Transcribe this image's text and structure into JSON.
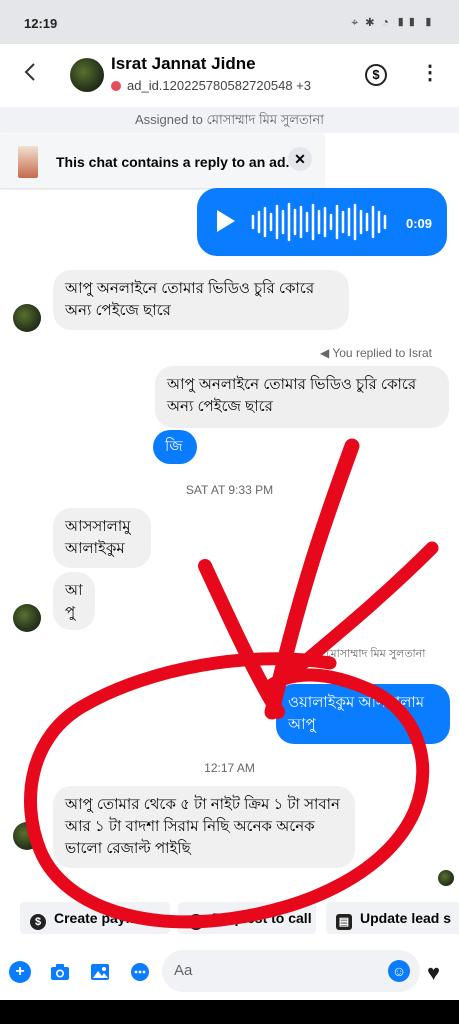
{
  "status_bar": {
    "time": "12:19",
    "icons": "⌖ ✱ ◔ ▮▮ ▮"
  },
  "header": {
    "name": "Israt Jannat Jidne",
    "subtitle": "ad_id.120225780582720548 +3",
    "back_icon": "chevron-left",
    "payment_icon": "$",
    "more_icon": "⋮"
  },
  "assigned_bar": "Assigned to মোসাম্মাদ মিম সুলতানা",
  "ad_banner": {
    "text": "This chat contains a reply to an ad.",
    "close": "✕"
  },
  "messages": {
    "voice": {
      "duration": "0:09"
    },
    "m1": "আপু অনলাইনে তোমার ভিডিও চুরি কোরে অন্য পেইজে ছারে",
    "replied_label": "You replied to Israt",
    "quoted": "আপু অনলাইনে তোমার ভিডিও চুরি কোরে অন্য পেইজে ছারে",
    "reply": "জি",
    "ts1": "SAT AT 9:33 PM",
    "m2": "আসসালামু আলাইকুম",
    "m3": "আ পু",
    "sender_label": "মোসাম্মাদ মিম সুলতানা",
    "m4": "ওয়ালাইকুম আসসালাম আপু",
    "ts2": "12:17 AM",
    "m5": "আপু তোমার থেকে ৫ টা নাইট ক্রিম ১ টা সাবান আর ১ টা বাদশা সিরাম নিছি অনেক অনেক ভালো রেজাল্ট পাইছি"
  },
  "quick_actions": {
    "a1_icon": "$",
    "a1": "Create payment",
    "a2": "Request to call",
    "a3": "Update lead s"
  },
  "composer": {
    "placeholder": "Aa",
    "heart": "♥"
  },
  "colors": {
    "blue": "#0a7cff",
    "red_scribble": "#e8081b"
  }
}
